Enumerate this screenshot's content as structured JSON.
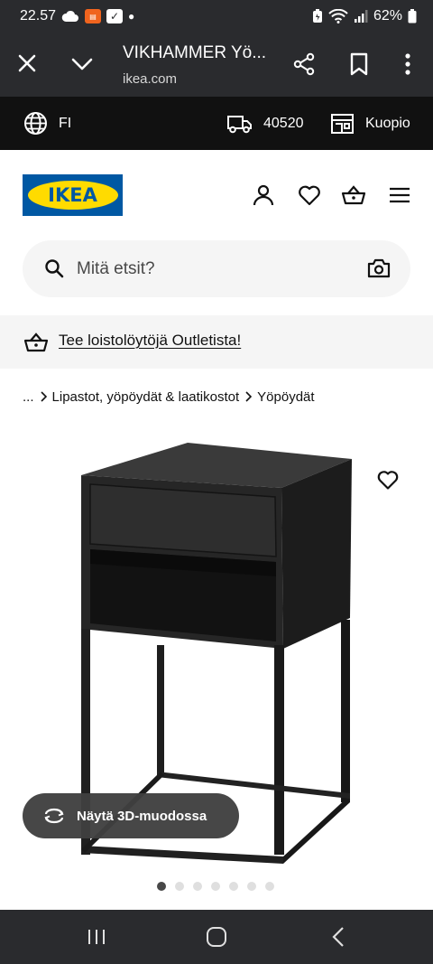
{
  "status_bar": {
    "time": "22.57",
    "battery": "62%",
    "icons": [
      "cloud-icon",
      "app-notification-icon",
      "checkbox-notification-icon",
      "dot-icon",
      "battery-saver-icon",
      "wifi-icon",
      "signal-icon",
      "battery-icon"
    ]
  },
  "browser": {
    "title": "VIKHAMMER Yö...",
    "url": "ikea.com",
    "icons": [
      "close-icon",
      "chevron-down-icon",
      "share-icon",
      "bookmark-icon",
      "more-icon"
    ]
  },
  "util_bar": {
    "language": "FI",
    "postal_code": "40520",
    "store": "Kuopio"
  },
  "header": {
    "logo_text": "IKEA",
    "brand_colors": {
      "blue": "#0058a3",
      "yellow": "#ffdb00"
    },
    "icons": [
      "user-icon",
      "heart-icon",
      "cart-icon",
      "menu-icon"
    ]
  },
  "search": {
    "placeholder": "Mitä etsit?"
  },
  "banner": {
    "text": "Tee loistolöytöjä Outletista!"
  },
  "breadcrumb": {
    "ellipsis": "...",
    "items": [
      "Lipastot, yöpöydät & laatikostot",
      "Yöpöydät"
    ]
  },
  "product": {
    "color": "#2b2b2b",
    "view_3d_label": "Näytä 3D-muodossa",
    "image_count": 7,
    "active_image": 1
  }
}
